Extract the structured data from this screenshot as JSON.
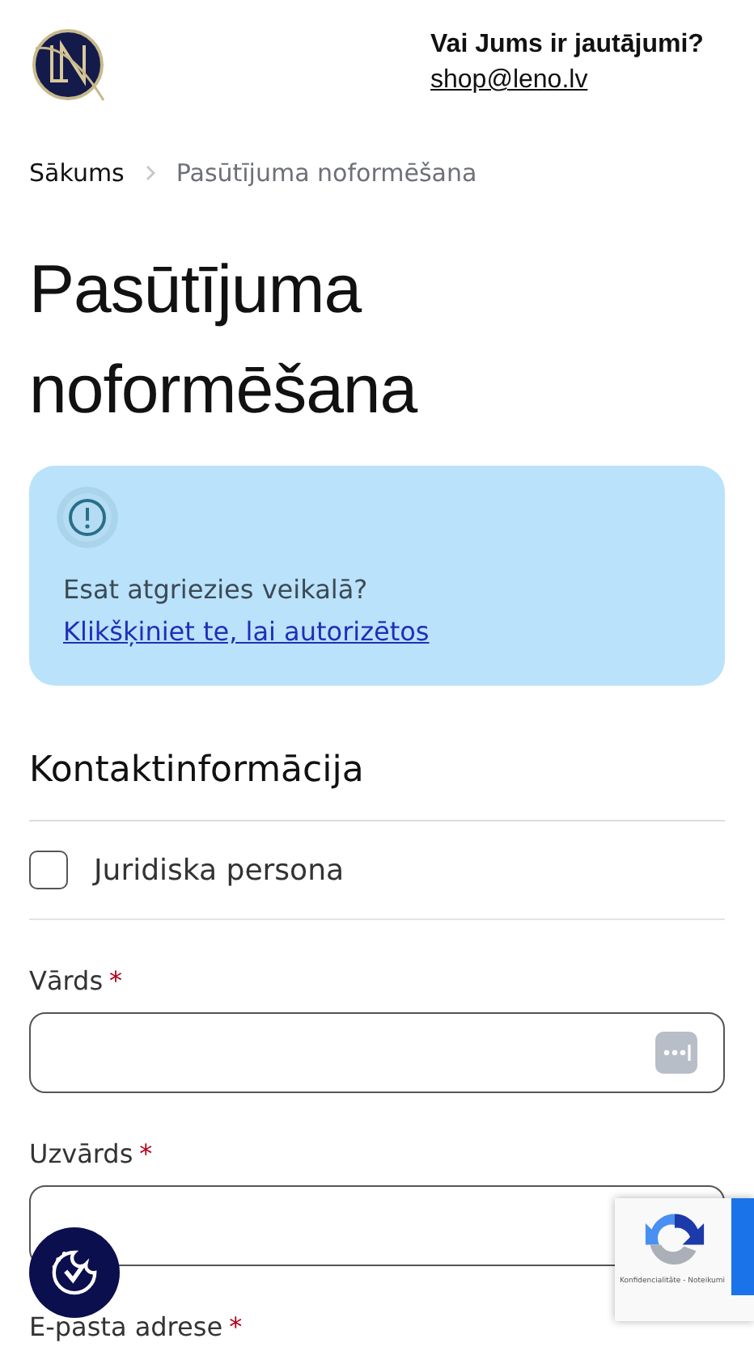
{
  "header": {
    "question": "Vai Jums ir jautājumi?",
    "email": "shop@leno.lv"
  },
  "breadcrumb": [
    {
      "label": "Sākums",
      "current": false
    },
    {
      "label": "Pasūtījuma noformēšana",
      "current": true
    }
  ],
  "title": "Pasūtījuma noformēšana",
  "notice": {
    "text": "Esat atgriezies veikalā?",
    "link": "Klikšķiniet te, lai autorizētos"
  },
  "section": "Kontaktinformācija",
  "company_checkbox": {
    "label": "Juridiska persona",
    "checked": false
  },
  "fields": [
    {
      "label": "Vārds",
      "required_mark": "*",
      "input_shown": true,
      "autofill_icon": true
    },
    {
      "label": "Uzvārds",
      "required_mark": "*",
      "input_shown": true
    },
    {
      "label": "E-pasta adrese",
      "required_mark": "*",
      "input_shown": false
    }
  ],
  "recaptcha": {
    "text": "Konfidencialitāte - Noteikumi"
  }
}
